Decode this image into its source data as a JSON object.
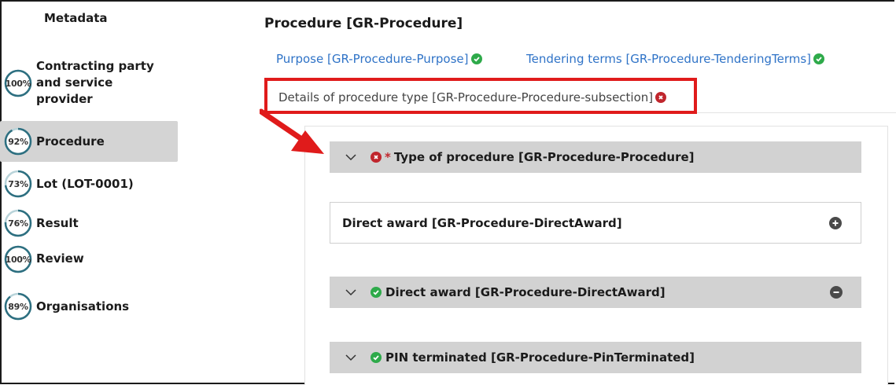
{
  "sidebar": {
    "title": "Metadata",
    "items": [
      {
        "percent": "100%",
        "fraction": 1.0,
        "label": "Contracting party and service provider",
        "lines": [
          "Contracting party",
          "and service",
          "provider"
        ],
        "active": false
      },
      {
        "percent": "92%",
        "fraction": 0.92,
        "label": "Procedure",
        "active": true
      },
      {
        "percent": "73%",
        "fraction": 0.73,
        "label": "Lot (LOT-0001)",
        "active": false
      },
      {
        "percent": "76%",
        "fraction": 0.76,
        "label": "Result",
        "active": false
      },
      {
        "percent": "100%",
        "fraction": 1.0,
        "label": "Review",
        "active": false
      },
      {
        "percent": "89%",
        "fraction": 0.89,
        "label": "Organisations",
        "active": false
      }
    ]
  },
  "main": {
    "title": "Procedure [GR-Procedure]",
    "tabs": [
      {
        "label": "Purpose  [GR-Procedure-Purpose]",
        "status": "ok"
      },
      {
        "label": "Tendering terms  [GR-Procedure-TenderingTerms]",
        "status": "ok"
      },
      {
        "label": "Details of procedure type  [GR-Procedure-Procedure-subsection]",
        "status": "error",
        "selected": true
      }
    ],
    "sections": [
      {
        "label": "Type of procedure  [GR-Procedure-Procedure]",
        "status": "error",
        "required": "*",
        "kind": "header"
      },
      {
        "label": "Direct award  [GR-Procedure-DirectAward]",
        "kind": "addable",
        "action_icon": "plus-circle-icon"
      },
      {
        "label": "Direct award  [GR-Procedure-DirectAward]",
        "status": "ok",
        "kind": "header",
        "action_icon": "minus-circle-icon"
      },
      {
        "label": "PIN terminated  [GR-Procedure-PinTerminated]",
        "status": "ok",
        "kind": "header"
      }
    ]
  },
  "colors": {
    "link": "#2f73c7",
    "ok": "#2eaa4a",
    "error": "#c0262d",
    "highlight": "#e01b1b",
    "accordion_bg": "#d2d2d2",
    "progress": "#2d6f80"
  },
  "annotation": {
    "icon": "red-arrow-icon"
  }
}
